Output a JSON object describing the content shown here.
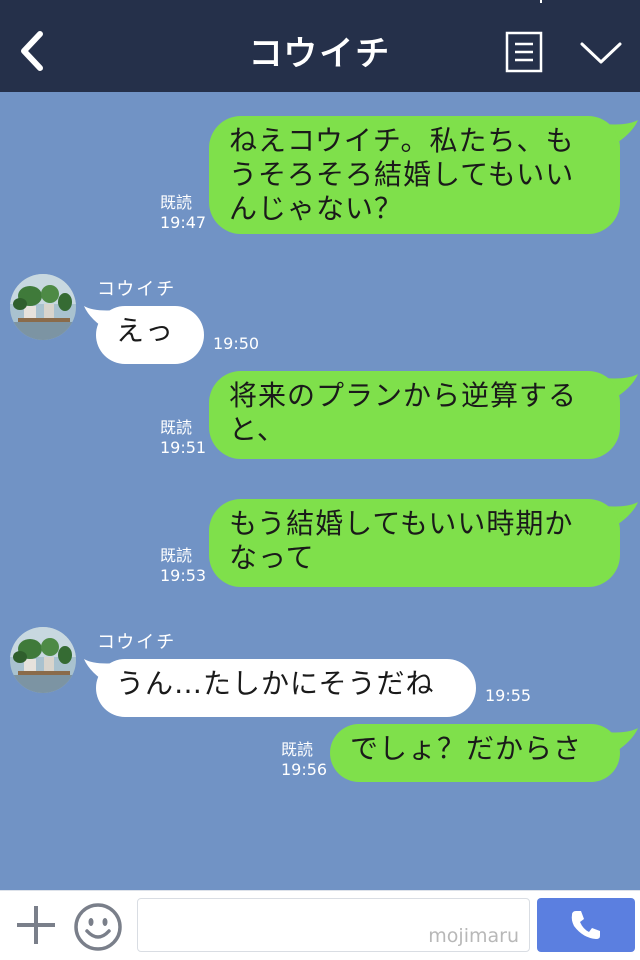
{
  "header": {
    "title": "コウイチ",
    "back_icon": "chevron-left-icon",
    "menu_icon": "list-icon",
    "expand_icon": "chevron-down-icon"
  },
  "messages": [
    {
      "direction": "out",
      "lines": [
        "ねえコウイチ。私たち、も",
        "うそろそろ結婚してもいい",
        "んじゃない？"
      ],
      "read": "既読",
      "time": "19:47"
    },
    {
      "direction": "in",
      "sender": "コウイチ",
      "lines": [
        "えっ"
      ],
      "time": "19:50"
    },
    {
      "direction": "out",
      "lines": [
        "将来のプランから逆算する",
        "と、"
      ],
      "read": "既読",
      "time": "19:51"
    },
    {
      "direction": "out",
      "lines": [
        "もう結婚してもいい時期か",
        "なって"
      ],
      "read": "既読",
      "time": "19:53"
    },
    {
      "direction": "in",
      "sender": "コウイチ",
      "lines": [
        "うん…たしかにそうだね"
      ],
      "time": "19:55"
    },
    {
      "direction": "out",
      "lines": [
        "でしょ？だからさ"
      ],
      "read": "既読",
      "time": "19:56"
    }
  ],
  "footer": {
    "add_icon": "plus-icon",
    "emoji_icon": "smile-icon",
    "input_value": "",
    "watermark": "mojimaru",
    "call_icon": "phone-icon"
  },
  "colors": {
    "header_bg": "#25304a",
    "chat_bg": "#7193c5",
    "outgoing_bubble": "#7fe04b",
    "incoming_bubble": "#ffffff",
    "call_button": "#5b7fe0"
  }
}
